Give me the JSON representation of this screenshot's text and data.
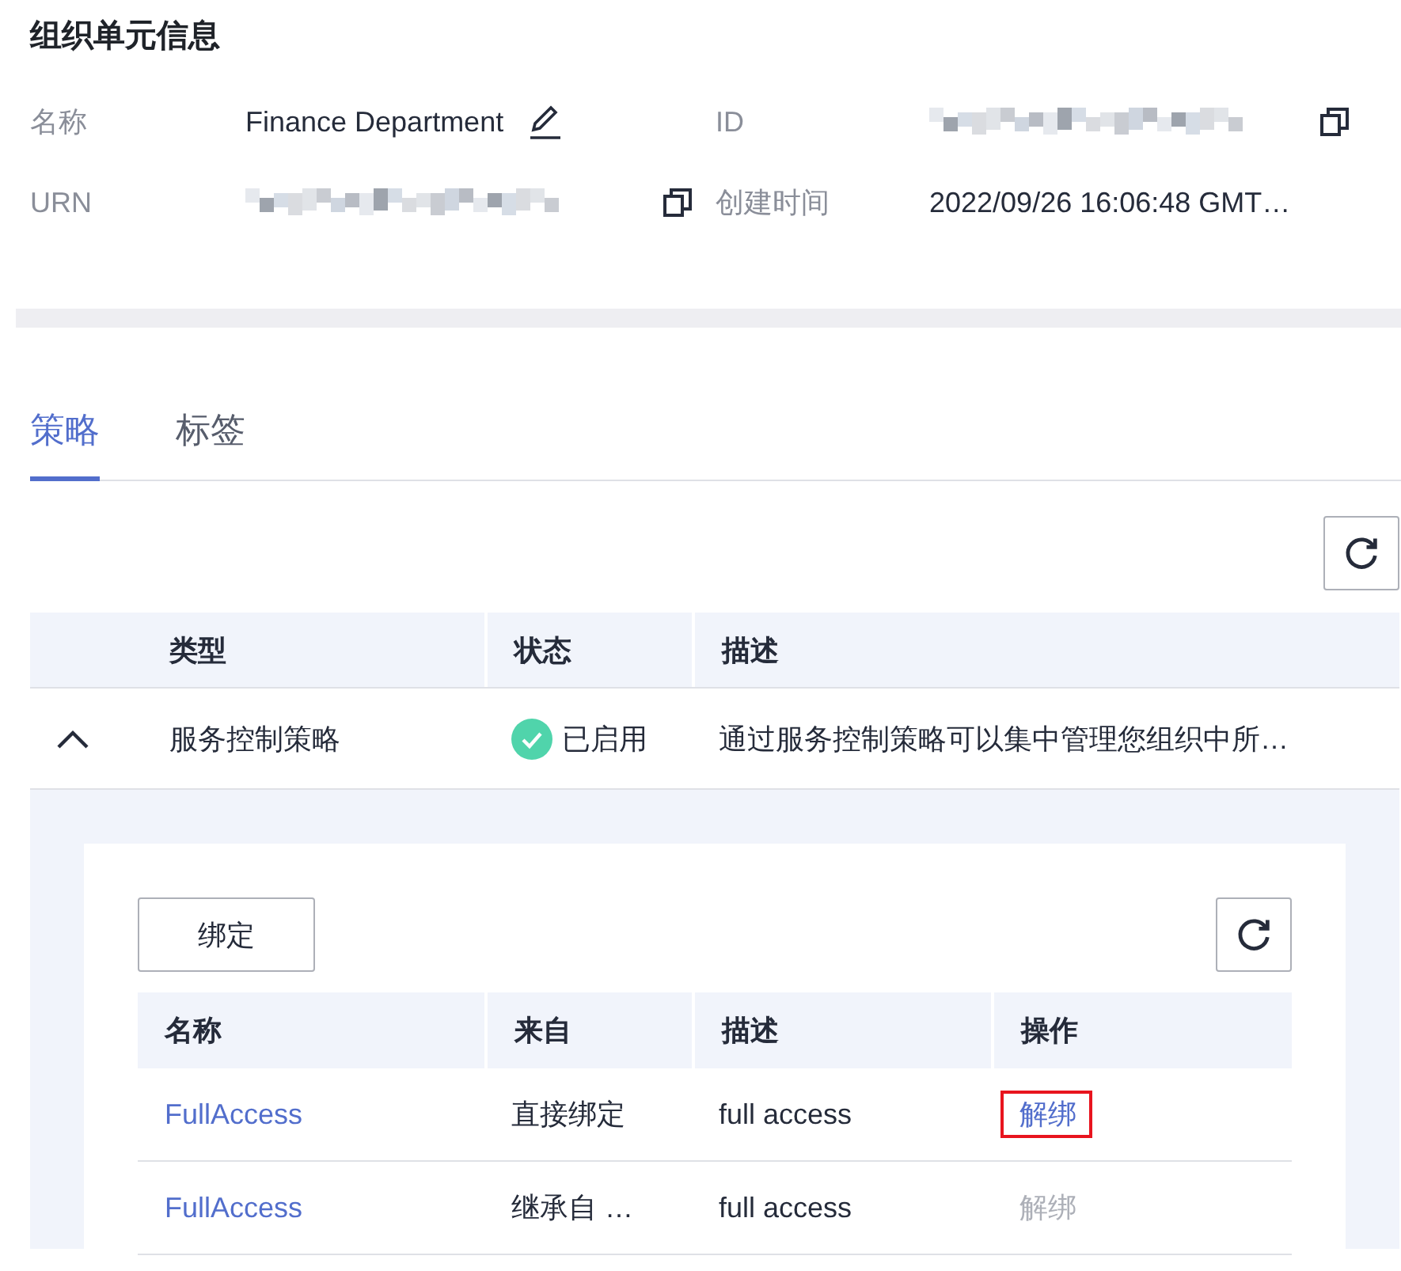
{
  "info": {
    "title": "组织单元信息",
    "fields": [
      {
        "label": "名称",
        "value": "Finance Department",
        "kind": "editable"
      },
      {
        "label": "ID",
        "kind": "redacted"
      },
      {
        "label": "URN",
        "kind": "redacted"
      },
      {
        "label": "创建时间",
        "value": "2022/09/26 16:06:48 GMT…",
        "kind": "plain"
      }
    ]
  },
  "tabs": [
    {
      "label": "策略",
      "selected": true
    },
    {
      "label": "标签",
      "selected": false
    }
  ],
  "policy_table": {
    "columns": [
      "类型",
      "状态",
      "描述"
    ],
    "rows": [
      {
        "type": "服务控制策略",
        "status": "已启用",
        "enabled": true,
        "description": "通过服务控制策略可以集中管理您组织中所…",
        "expanded": true
      }
    ]
  },
  "bind_button": "绑定",
  "bound_table": {
    "columns": [
      "名称",
      "来自",
      "描述",
      "操作"
    ],
    "rows": [
      {
        "name": "FullAccess",
        "source": "直接绑定",
        "description": "full access",
        "action": "解绑",
        "disabled": false,
        "highlighted": true
      },
      {
        "name": "FullAccess",
        "source": "继承自 …",
        "description": "full access",
        "action": "解绑",
        "disabled": true,
        "highlighted": false
      }
    ]
  }
}
